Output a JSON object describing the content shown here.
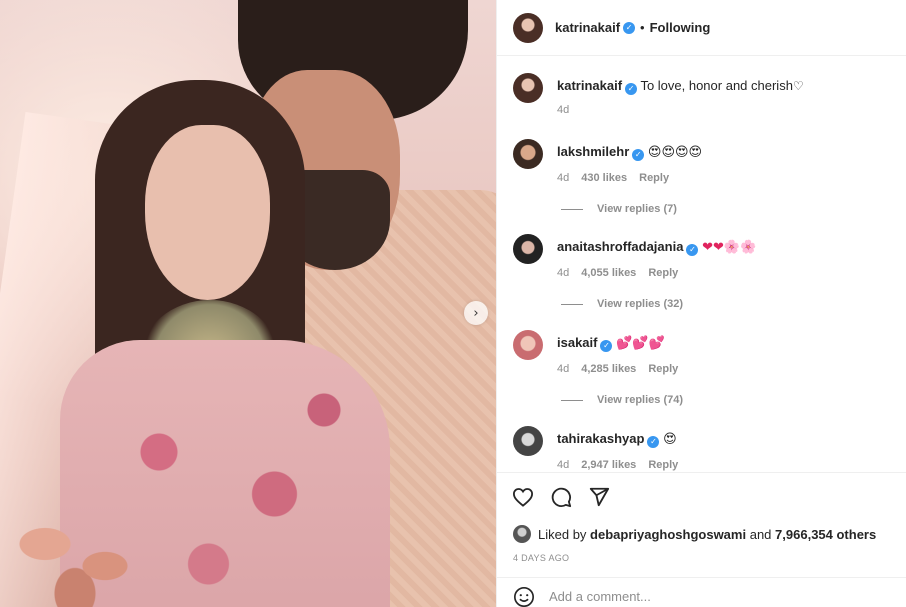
{
  "post": {
    "author": "katrinakaif",
    "follow_status": "Following",
    "separator": "•",
    "next_icon": "chevron-right-icon"
  },
  "comments": [
    {
      "user": "katrinakaif",
      "text": "To love, honor and cherish",
      "trailing": "♡",
      "time": "4d",
      "likes": "",
      "reply": "",
      "view_replies": ""
    },
    {
      "user": "lakshmilehr",
      "text": "😍😍😍😍",
      "trailing": "",
      "time": "4d",
      "likes": "430 likes",
      "reply": "Reply",
      "view_replies": "View replies (7)"
    },
    {
      "user": "anaitashroffadajania",
      "text": "❤❤🌸🌸",
      "trailing": "",
      "time": "4d",
      "likes": "4,055 likes",
      "reply": "Reply",
      "view_replies": "View replies (32)"
    },
    {
      "user": "isakaif",
      "text": "💕💕💕",
      "trailing": "",
      "time": "4d",
      "likes": "4,285 likes",
      "reply": "Reply",
      "view_replies": "View replies (74)"
    },
    {
      "user": "tahirakashyap",
      "text": "😍",
      "trailing": "",
      "time": "4d",
      "likes": "2,947 likes",
      "reply": "Reply",
      "view_replies": ""
    }
  ],
  "actions": {
    "like_icon": "heart-outline-icon",
    "comment_icon": "comment-icon",
    "share_icon": "paper-plane-icon"
  },
  "likes": {
    "prefix": "Liked by",
    "user": "debapriyaghoshgoswami",
    "and": "and",
    "others": "7,966,354 others"
  },
  "timestamp": "4 DAYS AGO",
  "add_comment": {
    "placeholder": "Add a comment...",
    "emoji_icon": "smiley-icon"
  },
  "colors": {
    "verified": "#3897f0",
    "muted": "#8e8e8e",
    "text": "#262626",
    "border": "#efefef"
  }
}
